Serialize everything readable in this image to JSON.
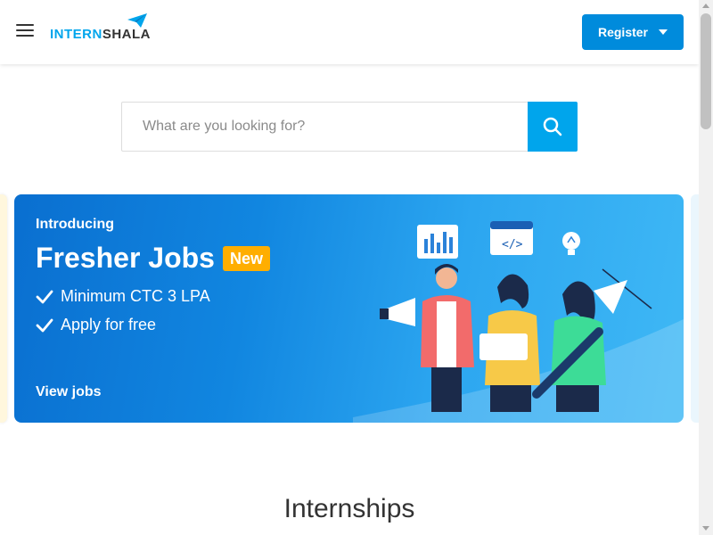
{
  "header": {
    "logo_part1": "INTERN",
    "logo_part2": "SHALA",
    "register_label": "Register"
  },
  "search": {
    "placeholder": "What are you looking for?"
  },
  "banner": {
    "intro": "Introducing",
    "headline": "Fresher Jobs",
    "badge": "New",
    "features": [
      "Minimum CTC 3 LPA",
      "Apply for free"
    ],
    "cta": "View jobs"
  },
  "section": {
    "title": "Internships"
  },
  "colors": {
    "brand": "#00a5ec",
    "register": "#008bdc",
    "badge": "#ffae00"
  }
}
